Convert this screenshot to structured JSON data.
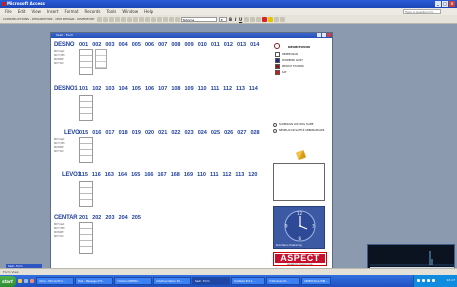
{
  "window": {
    "title": "Microsoft Access"
  },
  "menu": [
    "File",
    "Edit",
    "View",
    "Insert",
    "Format",
    "Records",
    "Tools",
    "Window",
    "Help"
  ],
  "help_box": {
    "placeholder": "Type a question for help"
  },
  "toolbar": {
    "segments": [
      "CONSTRUCTIONS - DESCRIPTION - CPM DESIGN - INVENTORY"
    ],
    "font_name": "Tahoma",
    "font_size": "8",
    "format_buttons": [
      "B",
      "I",
      "U"
    ]
  },
  "form": {
    "title": "Seat - Form",
    "status_labels": [
      "NOT Kept",
      "NOT CHM",
      "NOTAWE",
      "NOT SVC"
    ],
    "sections": [
      {
        "name": "DESNO",
        "codes": [
          "001",
          "002",
          "003",
          "004",
          "005",
          "006",
          "007",
          "008",
          "009",
          "010",
          "011",
          "012",
          "013",
          "014"
        ]
      },
      {
        "name": "DESNO1",
        "codes": [
          "101",
          "102",
          "103",
          "104",
          "105",
          "106",
          "107",
          "108",
          "109",
          "110",
          "111",
          "112",
          "113",
          "114"
        ]
      },
      {
        "name": "LEVO",
        "codes": [
          "015",
          "016",
          "017",
          "018",
          "019",
          "020",
          "021",
          "022",
          "023",
          "024",
          "025",
          "026",
          "027",
          "028"
        ]
      },
      {
        "name": "LEVO1",
        "codes": [
          "115",
          "116",
          "163",
          "164",
          "165",
          "166",
          "167",
          "168",
          "169",
          "110",
          "111",
          "112",
          "113",
          "120"
        ]
      },
      {
        "name": "CENTAR",
        "codes": [
          "201",
          "202",
          "203",
          "204",
          "205"
        ]
      }
    ],
    "legend_title": "NEOBITOVNU",
    "legend": [
      {
        "label": "REZERVISAN",
        "color": "#ffffff"
      },
      {
        "label": "POSREDNI GOST",
        "color": "#1a2a8c"
      },
      {
        "label": "PRODAT STVARNI",
        "color": "#8a1c1c"
      },
      {
        "label": "SAT",
        "color": "#d11a1a"
      }
    ],
    "radio_options": [
      "SLOBODAN LOK NOG SLIME",
      "NEOBLACAN SATTLE ABBONAMALEK"
    ],
    "clock_caption": "Kinki Nenu Vrsaturnog",
    "clock_numerals": [
      "12",
      "3",
      "6",
      "9"
    ],
    "logo_text": "ASPECT",
    "logo_sub": "ADVANCED TEHNOLOGIJE",
    "copyright": "© 2005 www.aspekt.rs"
  },
  "statusbar": {
    "text": "Form View"
  },
  "minimized_window": {
    "title": "Seat - Form"
  },
  "taskbar": {
    "start": "start",
    "tasks": [
      "Inbox - Microsoft O...",
      "Pest - Message (HT...",
      "Y-LOGO-ASPEKTA...",
      "hotelfoundation 30...",
      "Seat - Form",
      "OneNote Ext 2...",
      "3 Windows Ex...",
      "ASPEKT-bina WIN..."
    ],
    "active_task": "Seat - Form",
    "time": "12:17"
  },
  "memory_widget": {
    "label": "09-11-2011 12:24 RAM MEMORY"
  },
  "colors": {
    "titlebar": "#2a5bd7",
    "section_text": "#1d3f9c",
    "logo_red": "#c8102e",
    "taskbar": "#2a60d0"
  }
}
